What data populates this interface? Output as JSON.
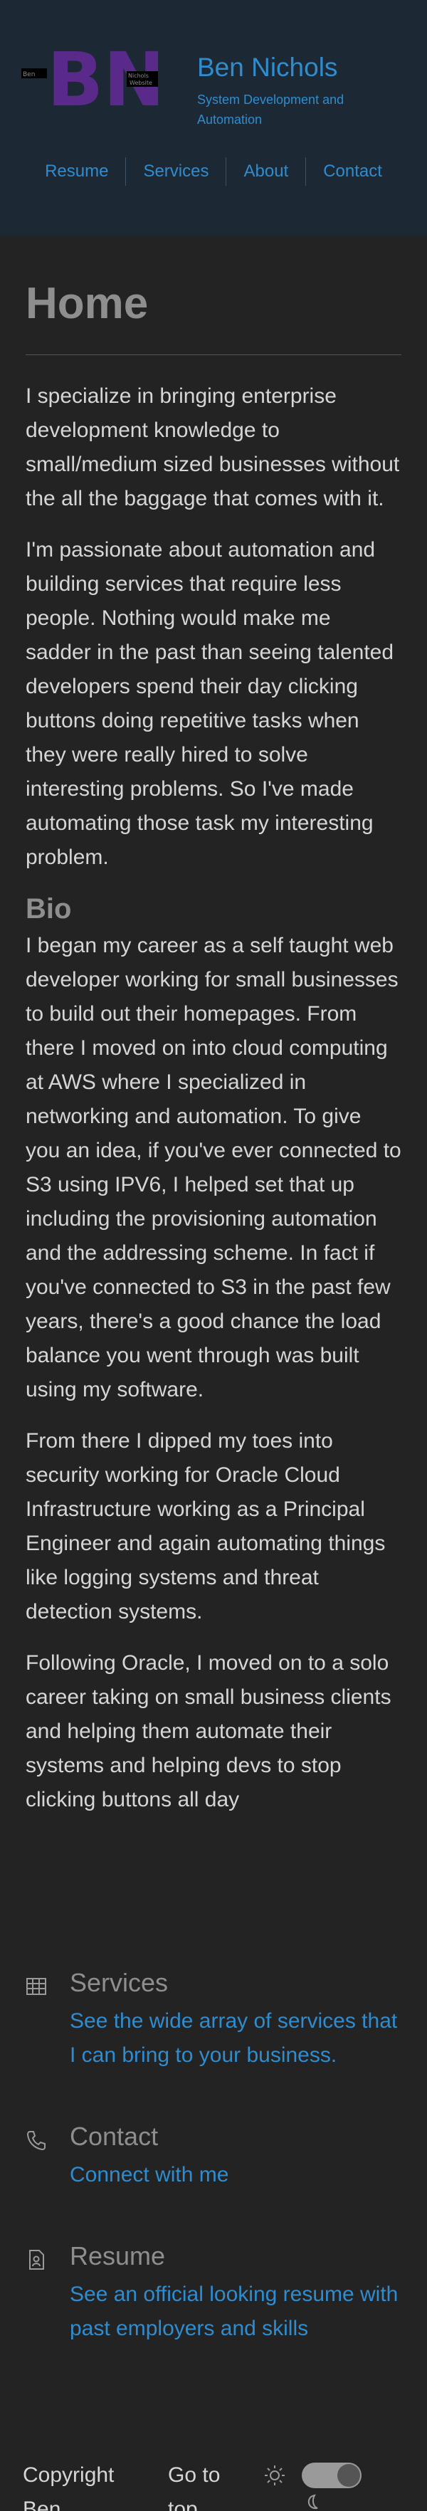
{
  "header": {
    "logo_letters": "BN",
    "logo_small_left": "Ben",
    "logo_small_right_top": "Nichols",
    "logo_small_right_bottom": "Website",
    "title": "Ben Nichols",
    "tagline": "System Development and Automation",
    "colors": {
      "background": "#1c2935",
      "accent": "#2f8ccf",
      "logo": "#5a2a8a"
    }
  },
  "nav": {
    "items": [
      {
        "label": "Resume"
      },
      {
        "label": "Services"
      },
      {
        "label": "About"
      },
      {
        "label": "Contact"
      }
    ]
  },
  "main": {
    "title": "Home",
    "intro": [
      "I specialize in bringing enterprise development knowledge to small/medium sized businesses without the all the baggage that comes with it.",
      "I'm passionate about automation and building services that require less people. Nothing would make me sadder in the past than seeing talented developers spend their day clicking buttons doing repetitive tasks when they were really hired to solve interesting problems. So I've made automating those task my interesting problem."
    ],
    "bio_heading": "Bio",
    "bio": [
      "I began my career as a self taught web developer working for small businesses to build out their homepages. From there I moved on into cloud computing at AWS where I specialized in networking and automation. To give you an idea, if you've ever connected to S3 using IPV6, I helped set that up including the provisioning automation and the addressing scheme. In fact if you've connected to S3 in the past few years, there's a good chance the load balance you went through was built using my software.",
      "From there I dipped my toes into security working for Oracle Cloud Infrastructure working as a Principal Engineer and again automating things like logging systems and threat detection systems.",
      "Following Oracle, I moved on to a solo career taking on small business clients and helping them automate their systems and helping devs to stop clicking buttons all day"
    ]
  },
  "links": {
    "services": {
      "icon": "grid-icon",
      "title": "Services",
      "link": "See the wide array of services that I can bring to your business."
    },
    "contact": {
      "icon": "phone-icon",
      "title": "Contact",
      "link": "Connect with me"
    },
    "resume": {
      "icon": "document-icon",
      "title": "Resume",
      "link": "See an official looking resume with past employers and skills"
    }
  },
  "footer": {
    "copyright": "Copyright Ben",
    "goto": "Go to top",
    "theme_toggle_icons": [
      "sun-icon",
      "moon-icon"
    ]
  }
}
